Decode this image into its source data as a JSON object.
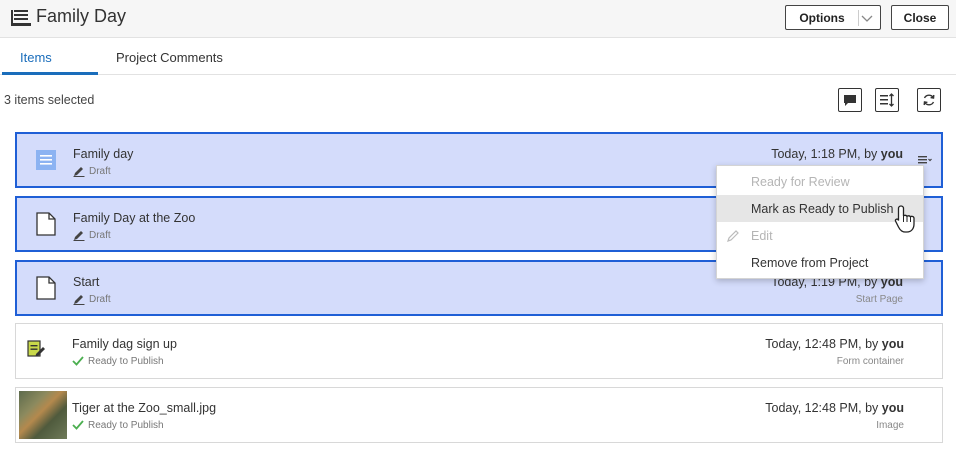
{
  "header": {
    "title": "Family Day",
    "options_label": "Options",
    "close_label": "Close"
  },
  "tabs": [
    {
      "label": "Items",
      "active": true
    },
    {
      "label": "Project Comments",
      "active": false
    }
  ],
  "toolbar": {
    "selection_text": "3 items selected"
  },
  "items": [
    {
      "name": "Family day",
      "status": "Draft",
      "meta_prefix": "Today, 1:18 PM, by ",
      "meta_user": "you",
      "type": "",
      "selected": true,
      "icon": "page-list-icon"
    },
    {
      "name": "Family Day at the Zoo",
      "status": "Draft",
      "meta_prefix": "",
      "meta_user": "",
      "type": "",
      "selected": true,
      "icon": "document-icon"
    },
    {
      "name": "Start",
      "status": "Draft",
      "meta_prefix": "Today, 1:19 PM, by ",
      "meta_user": "you",
      "type": "Start Page",
      "selected": true,
      "icon": "document-icon"
    },
    {
      "name": "Family dag sign up",
      "status": "Ready to Publish",
      "meta_prefix": "Today, 12:48 PM, by ",
      "meta_user": "you",
      "type": "Form container",
      "selected": false,
      "icon": "form-icon"
    },
    {
      "name": "Tiger at the Zoo_small.jpg",
      "status": "Ready to Publish",
      "meta_prefix": "Today, 12:48 PM, by ",
      "meta_user": "you",
      "type": "Image",
      "selected": false,
      "icon": "image-thumbnail"
    }
  ],
  "context_menu": {
    "items": [
      {
        "label": "Ready for Review",
        "disabled": true
      },
      {
        "label": "Mark as Ready to Publish",
        "disabled": false,
        "hover": true
      },
      {
        "label": "Edit",
        "disabled": true
      },
      {
        "label": "Remove from Project",
        "disabled": false
      }
    ]
  },
  "colors": {
    "accent": "#1a6dbb",
    "selection_bg": "#d4dcfb",
    "selection_border": "#1f5fd6",
    "ready_green": "#4caf50"
  }
}
